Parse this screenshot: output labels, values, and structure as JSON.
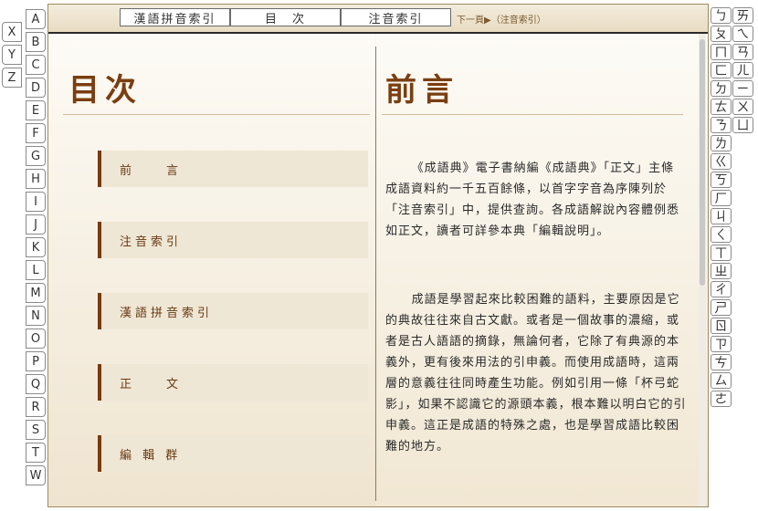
{
  "alpha_tabs_main": [
    "A",
    "B",
    "C",
    "D",
    "E",
    "F",
    "G",
    "H",
    "I",
    "J",
    "K",
    "L",
    "M",
    "N",
    "O",
    "P",
    "Q",
    "R",
    "S",
    "T",
    "W"
  ],
  "alpha_tabs_side": [
    "X",
    "Y",
    "Z"
  ],
  "zhuyin_tabs": [
    "ㄅ",
    "ㄞ",
    "ㄆ",
    "ㄟ",
    "ㄇ",
    "ㄢ",
    "ㄈ",
    "ㄦ",
    "ㄉ",
    "ㄧ",
    "ㄊ",
    "ㄨ",
    "ㄋ",
    "ㄩ",
    "ㄌ",
    "ㄍ",
    "ㄎ",
    "ㄏ",
    "ㄐ",
    "ㄑ",
    "ㄒ",
    "ㄓ",
    "ㄔ",
    "ㄕ",
    "ㄖ",
    "ㄗ",
    "ㄘ",
    "ㄙ",
    "ㄜ"
  ],
  "toolbar": {
    "pinyin_index": "漢語拼音索引",
    "contents": "目　次",
    "zhuyin_index": "注音索引",
    "next_page": "下一頁▶（注音索引）"
  },
  "left": {
    "title": "目次",
    "menu": [
      "前　　言",
      "注音索引",
      "漢語拼音索引",
      "正　　文",
      "編 輯 群"
    ]
  },
  "right": {
    "title": "前言",
    "paragraphs": [
      "《成語典》電子書納編《成語典》「正文」主條成語資料約一千五百餘條，以首字字音為序陳列於「注音索引」中，提供查詢。各成語解說內容體例悉如正文，讀者可詳參本典「編輯說明」。",
      "成語是學習起來比較困難的語料，主要原因是它的典故往往來自古文獻。或者是一個故事的濃縮，或者是古人語語的摘錄，無論何者，它除了有典源的本義外，更有後來用法的引申義。而使用成語時，這兩層的意義往往同時產生功能。例如引用一條「杯弓蛇影」，如果不認識它的源頭本義，根本難以明白它的引申義。這正是成語的特殊之處，也是學習成語比較困難的地方。"
    ]
  }
}
